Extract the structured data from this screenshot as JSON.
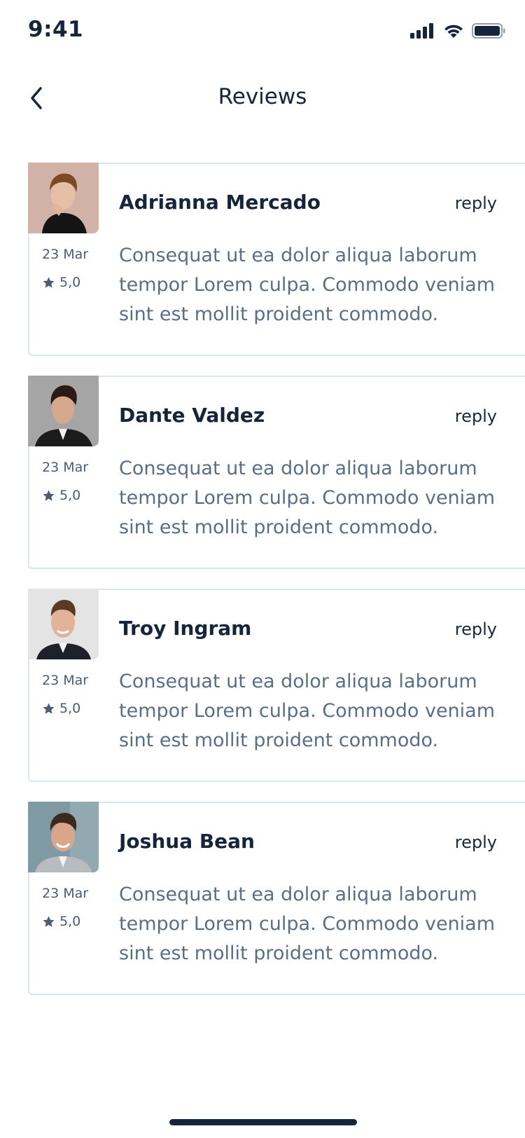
{
  "status_bar": {
    "time": "9:41"
  },
  "header": {
    "title": "Reviews"
  },
  "reviews": [
    {
      "name": "Adrianna Mercado",
      "reply_label": "reply",
      "date": "23 Mar",
      "rating": "5,0",
      "text": "Consequat ut ea dolor aliqua laborum tempor Lorem culpa. Commodo veniam sint est mollit proident commodo."
    },
    {
      "name": "Dante Valdez",
      "reply_label": "reply",
      "date": "23 Mar",
      "rating": "5,0",
      "text": "Consequat ut ea dolor aliqua laborum tempor Lorem culpa. Commodo veniam sint est mollit proident commodo."
    },
    {
      "name": "Troy Ingram",
      "reply_label": "reply",
      "date": "23 Mar",
      "rating": "5,0",
      "text": "Consequat ut ea dolor aliqua laborum tempor Lorem culpa. Commodo veniam sint est mollit proident commodo."
    },
    {
      "name": "Joshua Bean",
      "reply_label": "reply",
      "date": "23 Mar",
      "rating": "5,0",
      "text": "Consequat ut ea dolor aliqua laborum tempor Lorem culpa. Commodo veniam sint est mollit proident commodo."
    }
  ],
  "colors": {
    "text_primary": "#17253a",
    "text_secondary": "#5b6e84",
    "card_border": "#dde6ef",
    "background": "#ffffff"
  },
  "icons": {
    "back": "chevron-left-icon",
    "signal": "signal-icon",
    "wifi": "wifi-icon",
    "battery": "battery-icon",
    "star": "star-icon"
  }
}
